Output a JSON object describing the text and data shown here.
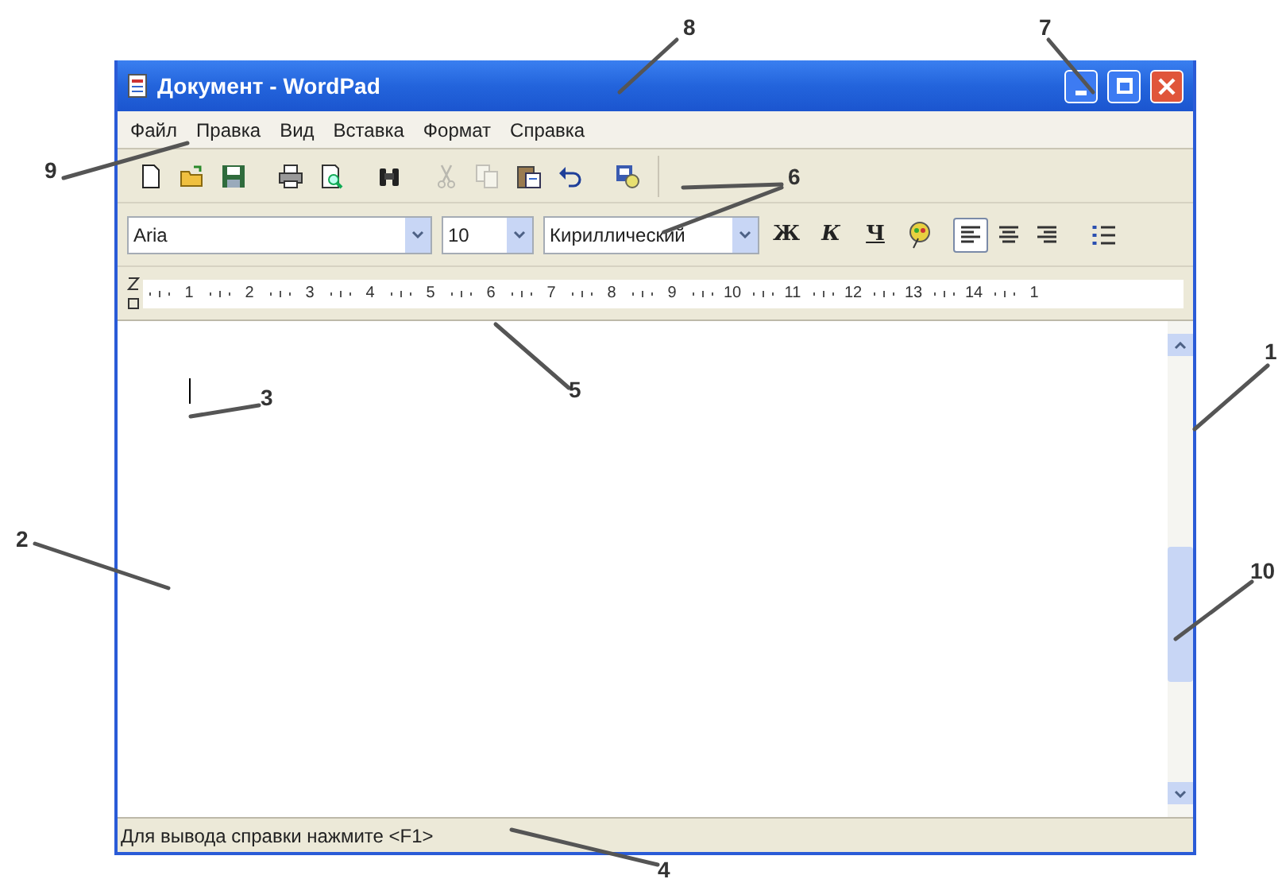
{
  "window": {
    "title": "Документ - WordPad"
  },
  "menu": [
    {
      "label": "Файл"
    },
    {
      "label": "Правка"
    },
    {
      "label": "Вид"
    },
    {
      "label": "Вставка"
    },
    {
      "label": "Формат"
    },
    {
      "label": "Справка"
    }
  ],
  "toolbar": [
    {
      "kind": "new",
      "disabled": false
    },
    {
      "kind": "open",
      "disabled": false
    },
    {
      "kind": "save",
      "disabled": false
    },
    {
      "kind": "print",
      "disabled": false
    },
    {
      "kind": "preview",
      "disabled": false
    },
    {
      "kind": "find",
      "disabled": false
    },
    {
      "kind": "cut",
      "disabled": true
    },
    {
      "kind": "copy",
      "disabled": true
    },
    {
      "kind": "paste",
      "disabled": false
    },
    {
      "kind": "undo",
      "disabled": false
    },
    {
      "kind": "datetime",
      "disabled": false
    }
  ],
  "format_bar": {
    "font": "Aria",
    "size": "10",
    "script": "Кириллический",
    "styles": [
      {
        "label": "Ж",
        "kind": "bold"
      },
      {
        "label": "К",
        "kind": "italic"
      },
      {
        "label": "Ч",
        "kind": "underline"
      }
    ],
    "alignment": [
      {
        "kind": "left",
        "selected": true
      },
      {
        "kind": "center",
        "selected": false
      },
      {
        "kind": "right",
        "selected": false
      }
    ]
  },
  "ruler": [
    "1",
    "2",
    "3",
    "4",
    "5",
    "6",
    "7",
    "8",
    "9",
    "10",
    "11",
    "12",
    "13",
    "14",
    "1"
  ],
  "status_bar": "Для вывода справки нажмите <F1>",
  "callouts": [
    {
      "label": "8"
    },
    {
      "label": "7"
    },
    {
      "label": "9"
    },
    {
      "label": "6"
    },
    {
      "label": "1"
    },
    {
      "label": "5"
    },
    {
      "label": "3"
    },
    {
      "label": "2"
    },
    {
      "label": "10"
    },
    {
      "label": "4"
    }
  ]
}
